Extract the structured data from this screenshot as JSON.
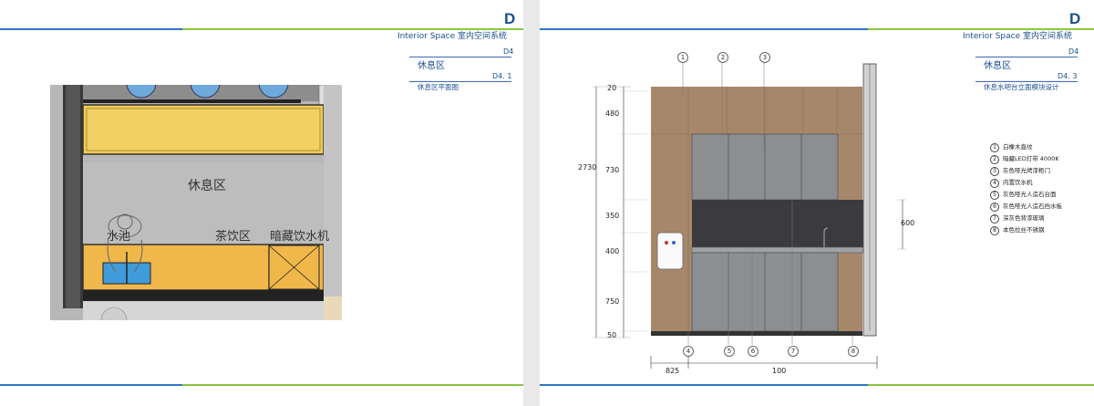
{
  "left": {
    "section_letter": "D",
    "subtitle": "Interior Space  室内空间系统",
    "code1": "D4",
    "label1": "休息区",
    "code2": "D4. 1",
    "label2": "休息区平面图",
    "plan": {
      "zone_rest": "休息区",
      "sink": "水池",
      "tea": "茶饮区",
      "water": "暗藏饮水机"
    }
  },
  "right": {
    "section_letter": "D",
    "subtitle": "Interior Space  室内空间系统",
    "code1": "D4",
    "label1": "休息区",
    "code2": "D4. 3",
    "label2": "休息水吧台立面模块设计",
    "dims_left": [
      "20",
      "480",
      "730",
      "350",
      "400",
      "750",
      "50"
    ],
    "total_height": "2730",
    "dim_right": "600",
    "dims_bottom": [
      "825",
      "100"
    ],
    "callouts": [
      "1",
      "2",
      "3",
      "4",
      "5",
      "6",
      "7",
      "8"
    ],
    "legend": [
      {
        "n": "1",
        "text": "白橡木直纹"
      },
      {
        "n": "2",
        "text": "暗藏LED灯带 4000K"
      },
      {
        "n": "3",
        "text": "灰色哑光烤漆柜门"
      },
      {
        "n": "4",
        "text": "内置饮水机"
      },
      {
        "n": "5",
        "text": "灰色哑光人造石台面"
      },
      {
        "n": "6",
        "text": "灰色哑光人造石挡水板"
      },
      {
        "n": "7",
        "text": "深灰色背漆玻璃"
      },
      {
        "n": "8",
        "text": "本色拉丝不锈钢"
      }
    ]
  },
  "colors": {
    "brand_blue": "#1d4e8f",
    "rule_green": "#8cc63f",
    "rule_blue": "#2f75c2",
    "wood": "#a7876a",
    "cabinet_grey": "#8c8f92"
  }
}
